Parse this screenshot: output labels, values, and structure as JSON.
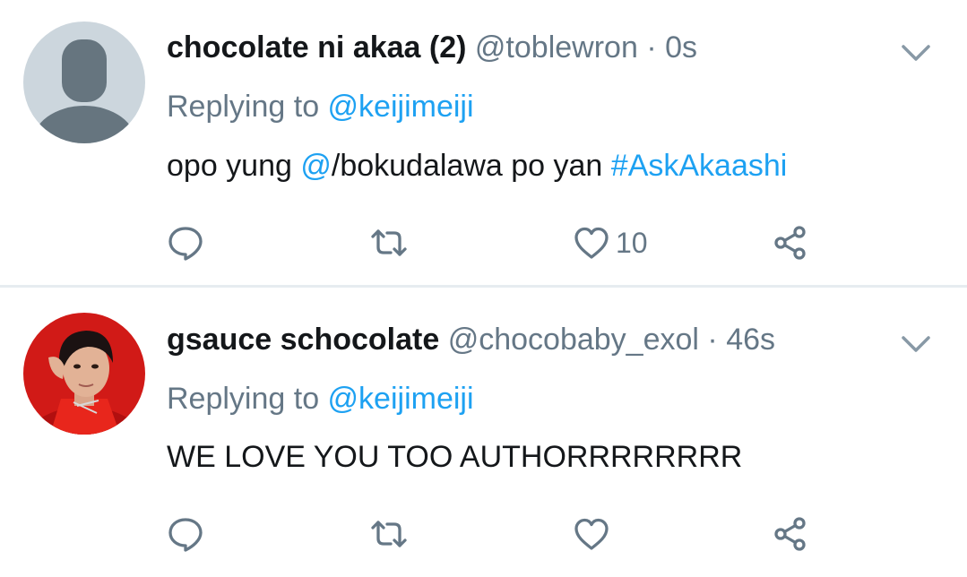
{
  "tweets": [
    {
      "display_name": "chocolate ni akaa (2)",
      "handle": "@toblewron",
      "time": "· 0s",
      "replying_prefix": "Replying to ",
      "replying_to": "@keijimeiji",
      "body_parts": [
        "opo yung ",
        "@",
        "/bokudalawa po yan ",
        "#AskAkaashi"
      ],
      "like_count": "10"
    },
    {
      "display_name": "gsauce schocolate",
      "handle": "@chocobaby_exol",
      "time": "· 46s",
      "replying_prefix": "Replying to ",
      "replying_to": "@keijimeiji",
      "body_parts": [
        "WE LOVE YOU TOO AUTHORRRRRRRR"
      ],
      "like_count": ""
    }
  ],
  "colors": {
    "link": "#1da1f2",
    "muted": "#657786",
    "text": "#14171a",
    "divider": "#e6ecf0"
  },
  "icons": [
    "default-avatar-icon",
    "chevron-down-icon",
    "reply-icon",
    "retweet-icon",
    "like-icon",
    "share-icon"
  ]
}
